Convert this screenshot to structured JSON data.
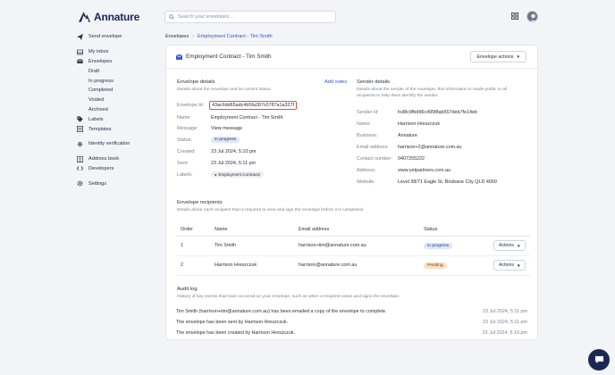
{
  "brand": {
    "name": "Annature"
  },
  "search": {
    "placeholder": "Search your envelopes..."
  },
  "sidebar": {
    "send_envelope": "Send envelope",
    "my_inbox": "My inbox",
    "envelopes": "Envelopes",
    "envelope_sub": [
      "Draft",
      "In progress",
      "Completed",
      "Voided",
      "Archived"
    ],
    "labels": "Labels",
    "templates": "Templates",
    "identity_verification": "Identity verification",
    "address_book": "Address book",
    "developers": "Developers",
    "settings": "Settings"
  },
  "breadcrumb": {
    "root": "Envelopes",
    "current": "Employment Contract - Tim Smith"
  },
  "card": {
    "title": "Employment Contract - Tim Smith",
    "actions_label": "Envelope actions"
  },
  "envelope_details": {
    "title": "Envelope details",
    "subtitle": "Details about the envelope and its current status.",
    "add_notes": "Add notes",
    "fields": {
      "id_label": "Envelope Id:",
      "id_value": "43ac6dd65adc4b5fa287c0787a1a327f",
      "name_label": "Name:",
      "name_value": "Employment Contract - Tim Smith",
      "message_label": "Message:",
      "message_value": "View message",
      "status_label": "Status:",
      "status_value": "In progress",
      "created_label": "Created:",
      "created_value": "23 Jul 2024, 5:10 pm",
      "sent_label": "Sent:",
      "sent_value": "23 Jul 2024, 5:11 pm",
      "labels_label": "Labels:",
      "labels_value": "Employment Contracts"
    }
  },
  "sender_details": {
    "title": "Sender details",
    "subtitle_line1": "Details about the sender of the envelope, this information is made public to all",
    "subtitle_line2": "recipients to help them identify the sender.",
    "fields": [
      {
        "label": "Sender Id:",
        "value": "fcd8c9fbd96c495f8ab557deb7fe14eb"
      },
      {
        "label": "Name:",
        "value": "Harrison Hreszczuk"
      },
      {
        "label": "Business:",
        "value": "Annature"
      },
      {
        "label": "Email address:",
        "value": "harrison+2@annature.com.au"
      },
      {
        "label": "Contact number:",
        "value": "0407255222"
      },
      {
        "label": "Address:",
        "value": "www.yetpartners.com.au"
      },
      {
        "label": "Website:",
        "value": "Level 38/71 Eagle St, Brisbane City QLD 4000"
      }
    ]
  },
  "recipients": {
    "title": "Envelope recipients",
    "subtitle": "Details about each recipient that is required to view and sign the envelope before it is completed.",
    "columns": [
      "Order",
      "Name",
      "Email address",
      "Status"
    ],
    "rows": [
      {
        "order": "1",
        "name": "Tim Smith",
        "email": "harrison+tim@annature.com.au",
        "status": "In progress",
        "action": "Actions"
      },
      {
        "order": "2",
        "name": "Harrison Hreszczuk",
        "email": "harrison@annature.com.au",
        "status": "Pending",
        "action": "Actions"
      }
    ]
  },
  "audit": {
    "title": "Audit log",
    "subtitle": "History of key events that have occurred on your envelope, such as when a recipient views and signs the envelope.",
    "rows": [
      {
        "text": "Tim Smith (harrison+tim@annature.com.au) has been emailed a copy of the envelope to complete.",
        "time": "23 Jul 2024, 5:11 pm"
      },
      {
        "text": "The envelope has been sent by Harrison Hreszczuk.",
        "time": "23 Jul 2024, 5:11 pm"
      },
      {
        "text": "The envelope has been created by Harrison Hreszczuk.",
        "time": "23 Jul 2024, 5:10 pm"
      }
    ]
  },
  "colors": {
    "brand": "#1c2753",
    "link": "#2f55c8",
    "highlight_border": "#e0543a",
    "pill_in_progress": "#dbe8fb",
    "pill_pending": "#fde0bf"
  }
}
